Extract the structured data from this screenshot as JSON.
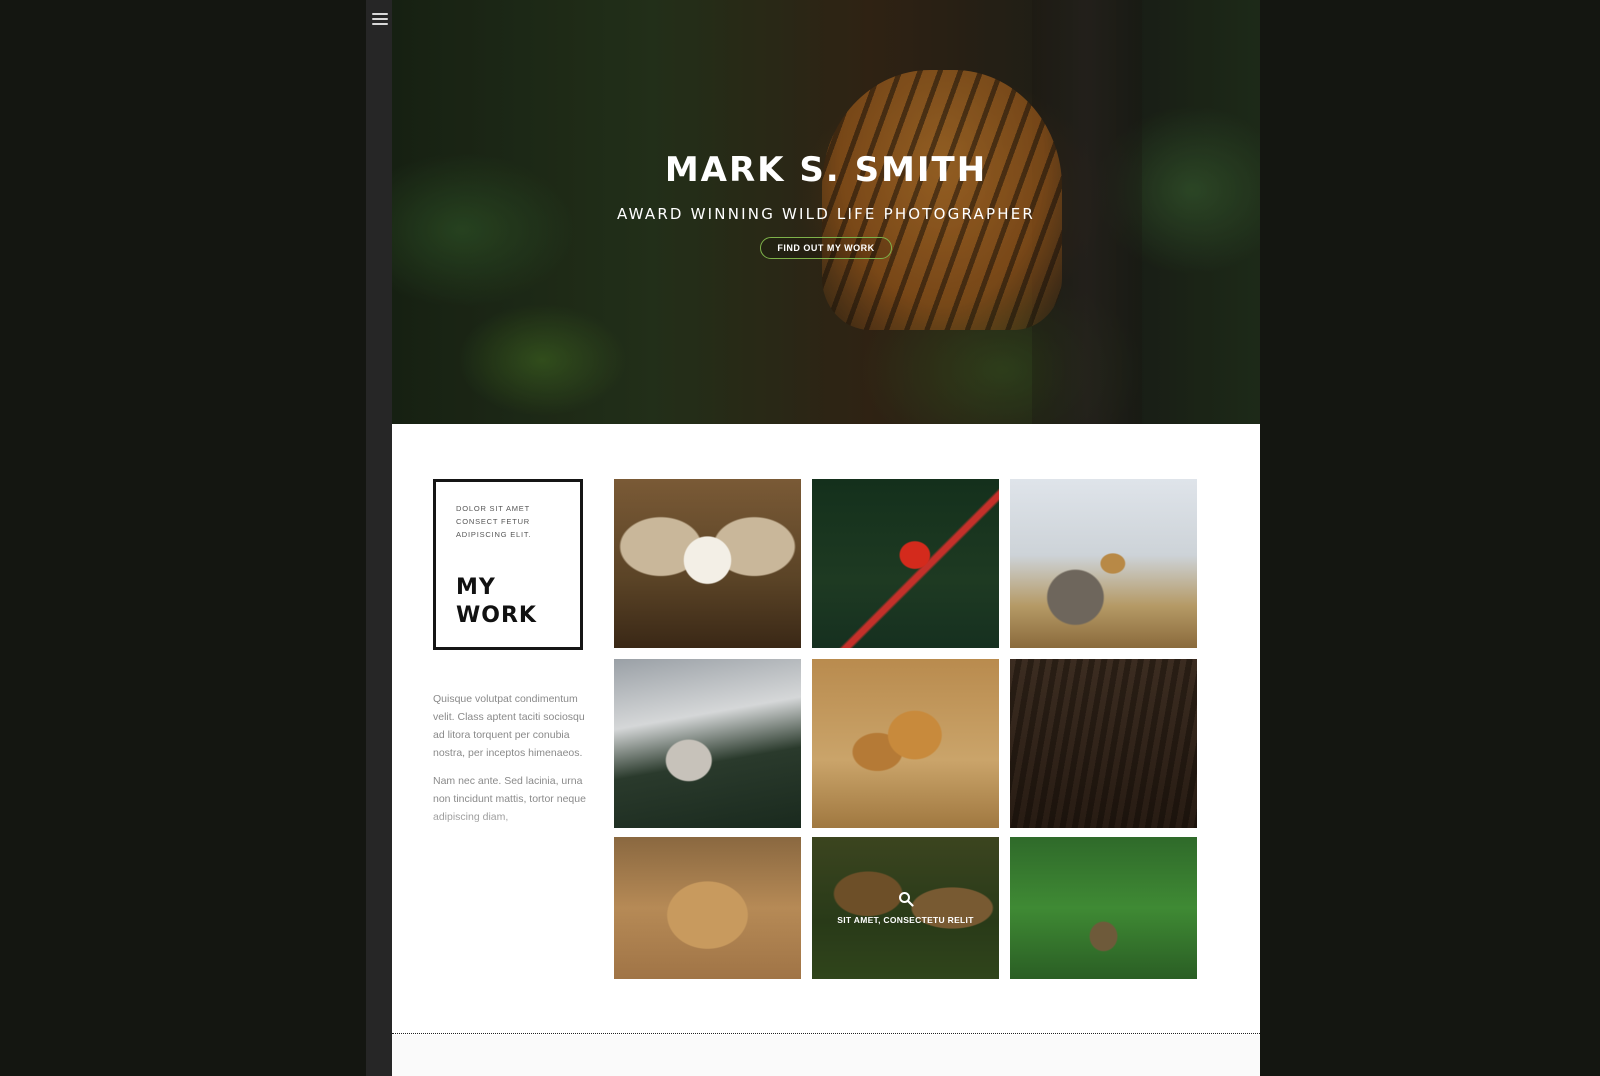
{
  "nav": {
    "menu_icon": "hamburger-menu-icon"
  },
  "hero": {
    "title": "MARK S. SMITH",
    "subtitle": "AWARD WINNING WILD LIFE PHOTOGRAPHER",
    "cta_label": "FIND OUT MY WORK",
    "accent_color": "#7eb24a"
  },
  "work": {
    "kicker": "DOLOR SIT AMET CONSECT FETUR ADIPISCING ELIT.",
    "heading": "MY WORK",
    "paragraphs": [
      "Quisque volutpat condimentum velit. Class aptent taciti sociosqu ad litora torquent per conubia nostra, per inceptos himenaeos.",
      "Nam nec ante. Sed lacinia, urna non tincidunt mattis, tortor neque adipiscing diam,"
    ]
  },
  "gallery": {
    "hover_caption": "SIT AMET, CONSECTETU RELIT",
    "hover_icon": "search-icon",
    "items": [
      {
        "subject": "squirrel monkey"
      },
      {
        "subject": "scarlet macaw in flight"
      },
      {
        "subject": "safari animals group"
      },
      {
        "subject": "wolf on misty mountain"
      },
      {
        "subject": "lion cubs"
      },
      {
        "subject": "wild boar piglets"
      },
      {
        "subject": "lions cuddling"
      },
      {
        "subject": "giraffes"
      },
      {
        "subject": "green forest path"
      }
    ]
  }
}
